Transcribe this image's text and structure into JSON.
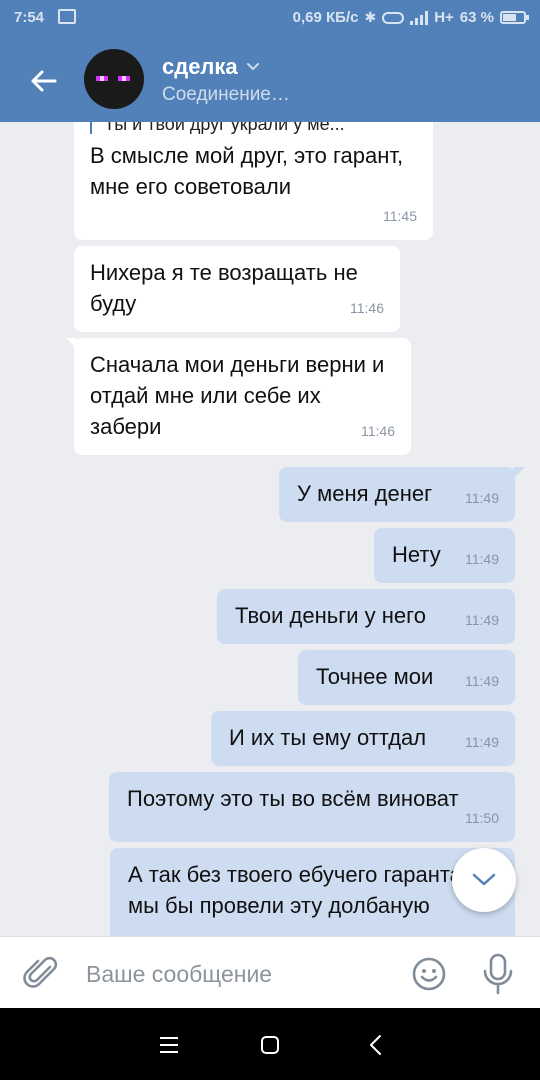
{
  "status_bar": {
    "time": "7:54",
    "net_speed": "0,69 КБ/с",
    "network": "H+",
    "battery": "63 %",
    "battery_level": 0.63
  },
  "header": {
    "title": "сделка",
    "subtitle": "Соединение…"
  },
  "messages": [
    {
      "direction": "in",
      "quote": "Ты и твой друг украли у ме...",
      "text": "В смысле мой друг, это гарант, мне его советовали",
      "time": "11:45"
    },
    {
      "direction": "in",
      "text": "Нихера я те возращать не буду",
      "time": "11:46"
    },
    {
      "direction": "in",
      "text": "Сначала мои деньги верни и отдай мне или себе их забери",
      "time": "11:46"
    },
    {
      "direction": "out",
      "text": "У меня денег",
      "time": "11:49"
    },
    {
      "direction": "out",
      "text": "Нету",
      "time": "11:49"
    },
    {
      "direction": "out",
      "text": "Твои деньги у него",
      "time": "11:49"
    },
    {
      "direction": "out",
      "text": "Точнее мои",
      "time": "11:49"
    },
    {
      "direction": "out",
      "text": "И их ты ему оттдал",
      "time": "11:49"
    },
    {
      "direction": "out",
      "text": "Поэтому это ты во всём виноват",
      "time": "11:50"
    },
    {
      "direction": "out",
      "text": "А так без твоего ебучего гаранта мы бы провели эту долбаную",
      "time": ""
    }
  ],
  "composer": {
    "placeholder": "Ваше сообщение"
  },
  "icons": {
    "back": "arrow-left-icon",
    "attach": "paperclip-icon",
    "emoji": "smiley-icon",
    "mic": "microphone-icon",
    "scroll_down": "chevron-down-icon"
  },
  "colors": {
    "header": "#5181b8",
    "incoming_bubble": "#ffffff",
    "outgoing_bubble": "#cddcf0",
    "background": "#ebedf0"
  }
}
